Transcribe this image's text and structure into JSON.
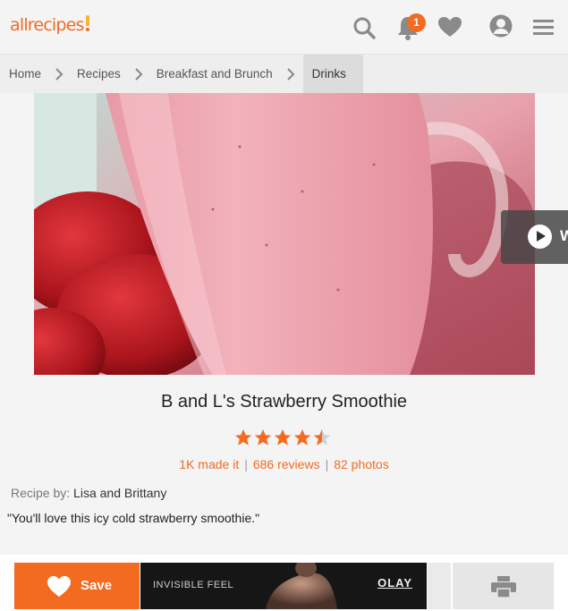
{
  "header": {
    "logo_text": "allrecipes",
    "notification_count": "1",
    "icons": [
      "search-icon",
      "bell-icon",
      "heart-icon",
      "profile-icon",
      "menu-icon"
    ],
    "accent_color": "#f26b21"
  },
  "breadcrumb": {
    "items": [
      "Home",
      "Recipes",
      "Breakfast and Brunch",
      "Drinks"
    ]
  },
  "video": {
    "label": "W"
  },
  "recipe": {
    "title": "B and L's Strawberry Smoothie",
    "rating": 4.5,
    "rating_max": 5,
    "made_it": "1K made it",
    "reviews": "686 reviews",
    "photos": "82 photos",
    "byline_label": "Recipe by:",
    "author": "Lisa and Brittany",
    "description": "\"You'll love this icy cold strawberry smoothie.\""
  },
  "actions": {
    "save_label": "Save"
  },
  "ad": {
    "text": "INVISIBLE FEEL",
    "brand": "OLAY"
  }
}
